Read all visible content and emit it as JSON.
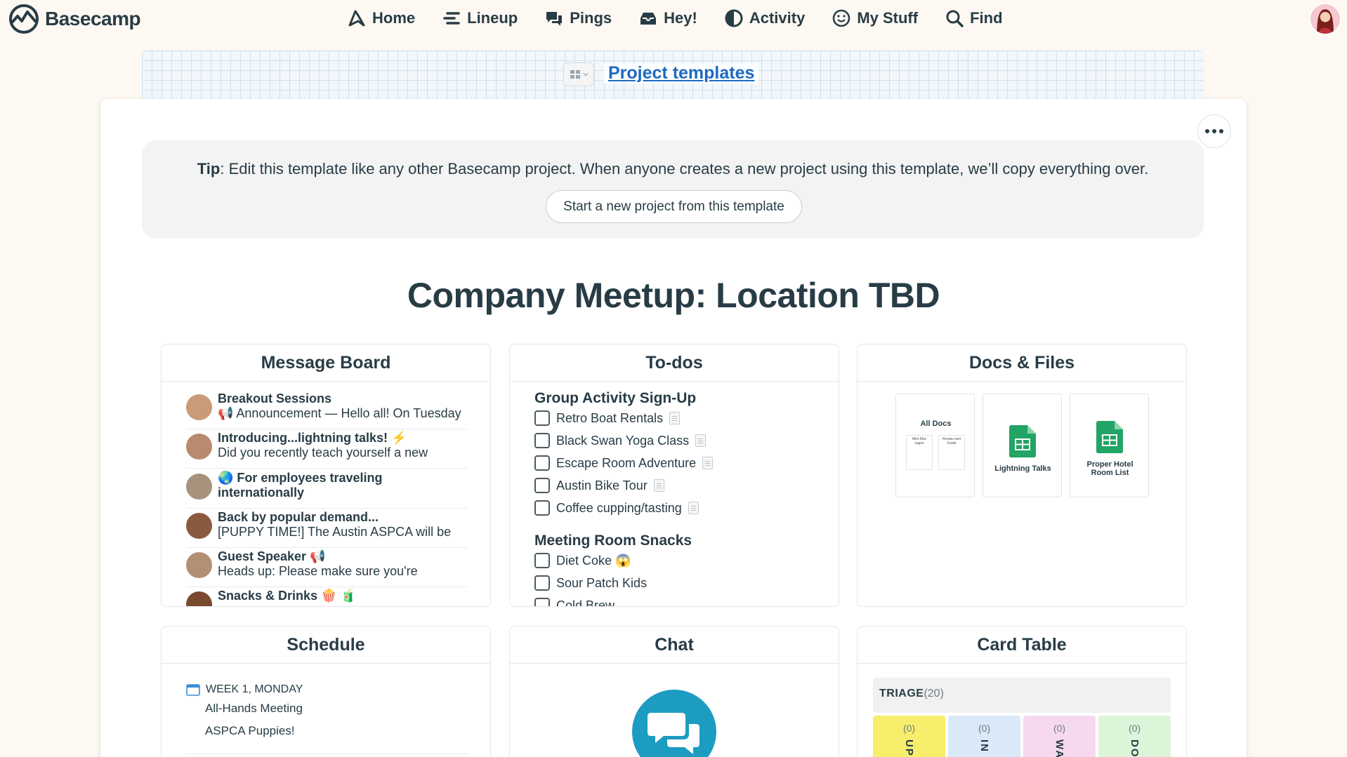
{
  "app": {
    "name": "Basecamp"
  },
  "nav": {
    "home": "Home",
    "lineup": "Lineup",
    "pings": "Pings",
    "hey": "Hey!",
    "activity": "Activity",
    "mystuff": "My Stuff",
    "find": "Find"
  },
  "breadcrumb": {
    "link": "Project templates"
  },
  "tip": {
    "label": "Tip",
    "text": ": Edit this template like any other Basecamp project. When anyone creates a new project using this template, we’ll copy everything over.",
    "button": "Start a new project from this template"
  },
  "project": {
    "title": "Company Meetup: Location TBD"
  },
  "message_board": {
    "title": "Message Board",
    "messages": [
      {
        "title": "Breakout Sessions",
        "snippet": "📢 Announcement — Hello all! On Tuesday"
      },
      {
        "title": "Introducing...lightning talks! ⚡",
        "snippet": "Did you recently teach yourself a new"
      },
      {
        "title": "🌏 For employees traveling",
        "title2": "internationally"
      },
      {
        "title": "Back by popular demand...",
        "snippet": "[PUPPY TIME!] The Austin ASPCA will be"
      },
      {
        "title": "Guest Speaker 📢",
        "snippet": "Heads up: Please make sure you're"
      },
      {
        "title": "Snacks & Drinks 🍿 🧃"
      }
    ]
  },
  "todos": {
    "title": "To-dos",
    "lists": [
      {
        "name": "Group Activity Sign-Up",
        "items": [
          "Retro Boat Rentals",
          "Black Swan Yoga Class",
          "Escape Room Adventure",
          "Austin Bike Tour",
          "Coffee cupping/tasting"
        ]
      },
      {
        "name": "Meeting Room Snacks",
        "items": [
          "Diet Coke 😱",
          "Sour Patch Kids",
          "Cold Brew"
        ]
      }
    ]
  },
  "docs": {
    "title": "Docs & Files",
    "items": [
      {
        "label": "All Docs",
        "sub1": "Mini-Mes sages",
        "sub2": "Restau-rant Guide"
      },
      {
        "label": "Lightning Talks"
      },
      {
        "label": "Proper Hotel Room List"
      }
    ]
  },
  "schedule": {
    "title": "Schedule",
    "date": "WEEK 1, MONDAY",
    "events": [
      "All-Hands Meeting",
      "ASPCA Puppies!"
    ]
  },
  "chat": {
    "title": "Chat"
  },
  "card_table": {
    "title": "Card Table",
    "triage_label": "TRIAGE",
    "triage_count": "(20)",
    "columns": [
      {
        "count": "(0)",
        "label": "UP",
        "color": "#f7ee6b"
      },
      {
        "count": "(0)",
        "label": "IN P",
        "color": "#d9e9f7"
      },
      {
        "count": "(0)",
        "label": "WA",
        "color": "#f7d9ef"
      },
      {
        "count": "(0)",
        "label": "DO",
        "color": "#dcf5d9"
      }
    ]
  },
  "colors": {
    "accent": "#1d6ac2",
    "chat": "#1c9cc0",
    "sheets": "#21a464"
  }
}
